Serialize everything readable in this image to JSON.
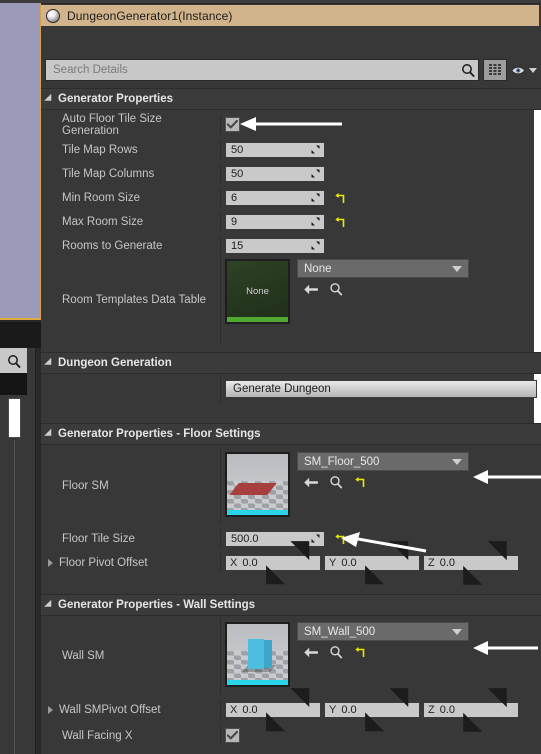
{
  "actor": {
    "name": "DungeonGenerator1(Instance)",
    "icon": "actor-orb-icon"
  },
  "search": {
    "placeholder": "Search Details",
    "icon": "search-icon"
  },
  "toolbar": {
    "grid_view_label": "grid-view-icon",
    "visibility_label": "eye-icon",
    "dropdown_label": "chevron-down-icon"
  },
  "categories": {
    "generator_properties": "Generator Properties",
    "dungeon_generation": "Dungeon Generation",
    "floor_settings": "Generator Properties - Floor Settings",
    "wall_settings": "Generator Properties - Wall Settings"
  },
  "properties": {
    "auto_floor_tile": {
      "label": "Auto Floor Tile Size Generation",
      "checked": true
    },
    "tile_map_rows": {
      "label": "Tile Map Rows",
      "value": "50",
      "reset": false
    },
    "tile_map_columns": {
      "label": "Tile Map Columns",
      "value": "50",
      "reset": false
    },
    "min_room_size": {
      "label": "Min Room Size",
      "value": "6",
      "reset": true
    },
    "max_room_size": {
      "label": "Max Room Size",
      "value": "9",
      "reset": true
    },
    "rooms_to_generate": {
      "label": "Rooms to Generate",
      "value": "15",
      "reset": false
    },
    "room_templates_data_table": {
      "label": "Room Templates Data Table",
      "thumbnail_text": "None",
      "selected": "None",
      "accent_color": "#4fa832"
    },
    "generate_dungeon": {
      "label": "Generate Dungeon"
    },
    "floor_sm": {
      "label": "Floor SM",
      "selected": "SM_Floor_500",
      "accent_color": "#2ad4e8"
    },
    "floor_tile_size": {
      "label": "Floor Tile Size",
      "value": "500.0",
      "reset": true
    },
    "floor_pivot_offset": {
      "label": "Floor Pivot Offset",
      "axes": [
        {
          "axis": "X",
          "value": "0.0"
        },
        {
          "axis": "Y",
          "value": "0.0"
        },
        {
          "axis": "Z",
          "value": "0.0"
        }
      ]
    },
    "wall_sm": {
      "label": "Wall SM",
      "selected": "SM_Wall_500",
      "accent_color": "#2ad4e8"
    },
    "wall_sm_pivot_offset": {
      "label": "Wall SMPivot Offset",
      "axes": [
        {
          "axis": "X",
          "value": "0.0"
        },
        {
          "axis": "Y",
          "value": "0.0"
        },
        {
          "axis": "Z",
          "value": "0.0"
        }
      ]
    },
    "wall_facing_x": {
      "label": "Wall Facing X",
      "checked": true
    }
  },
  "colors": {
    "panel_bg": "#383838",
    "category_bg": "#3b3b3b",
    "selection_bar": "#d2b48c",
    "field_bg": "#c9c9c9",
    "combo_bg": "#6a6a6a",
    "reset_arrow": "#e8e800",
    "left_viewport": "#9b9ab8",
    "left_viewport_border": "#e0a93e"
  },
  "annotations": {
    "arrow_auto_floor": "arrow-pointing-left",
    "arrow_floor_sm": "arrow-pointing-left",
    "arrow_floor_tile_size": "arrow-pointing-left",
    "arrow_wall_sm": "arrow-pointing-left"
  }
}
